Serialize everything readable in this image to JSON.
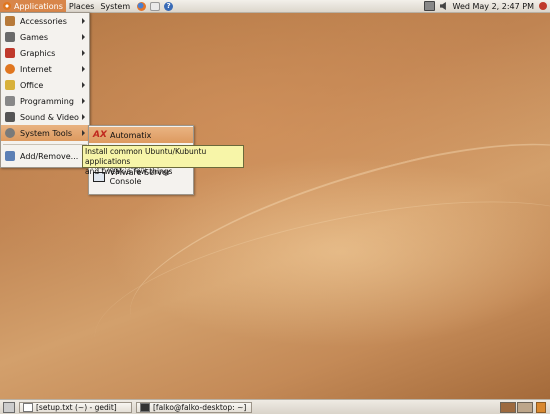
{
  "top_panel": {
    "menus": [
      "Applications",
      "Places",
      "System"
    ],
    "launchers": [
      "firefox-icon",
      "mail-icon",
      "help-icon"
    ],
    "help_glyph": "?",
    "clock": "Wed May  2,  2:47 PM"
  },
  "apps_menu": {
    "items": [
      {
        "label": "Accessories",
        "icon": "accessories-icon",
        "color": "#b77a3a"
      },
      {
        "label": "Games",
        "icon": "games-icon",
        "color": "#6a6a6a"
      },
      {
        "label": "Graphics",
        "icon": "graphics-icon",
        "color": "#c0392b"
      },
      {
        "label": "Internet",
        "icon": "internet-icon",
        "color": "#e0761f"
      },
      {
        "label": "Office",
        "icon": "office-icon",
        "color": "#d8b13a"
      },
      {
        "label": "Programming",
        "icon": "programming-icon",
        "color": "#888888"
      },
      {
        "label": "Sound & Video",
        "icon": "sound-video-icon",
        "color": "#555555"
      },
      {
        "label": "System Tools",
        "icon": "system-tools-icon",
        "color": "#7a7a7a"
      }
    ],
    "add_remove": "Add/Remove..."
  },
  "system_tools_menu": {
    "automatix": "Automatix",
    "hidden_item": "Find Jobs (Tools)",
    "vmware": "VMware Server Console"
  },
  "tooltip": {
    "line1": "Install common Ubuntu/Kubuntu applications",
    "line2": "and tweak a few things"
  },
  "bottom_panel": {
    "tasks": [
      "[setup.txt (~) - gedit]",
      "[falko@falko-desktop: ~]"
    ]
  },
  "colors": {
    "highlight": "#dd9a60",
    "tooltip_bg": "#f7f5a8"
  }
}
